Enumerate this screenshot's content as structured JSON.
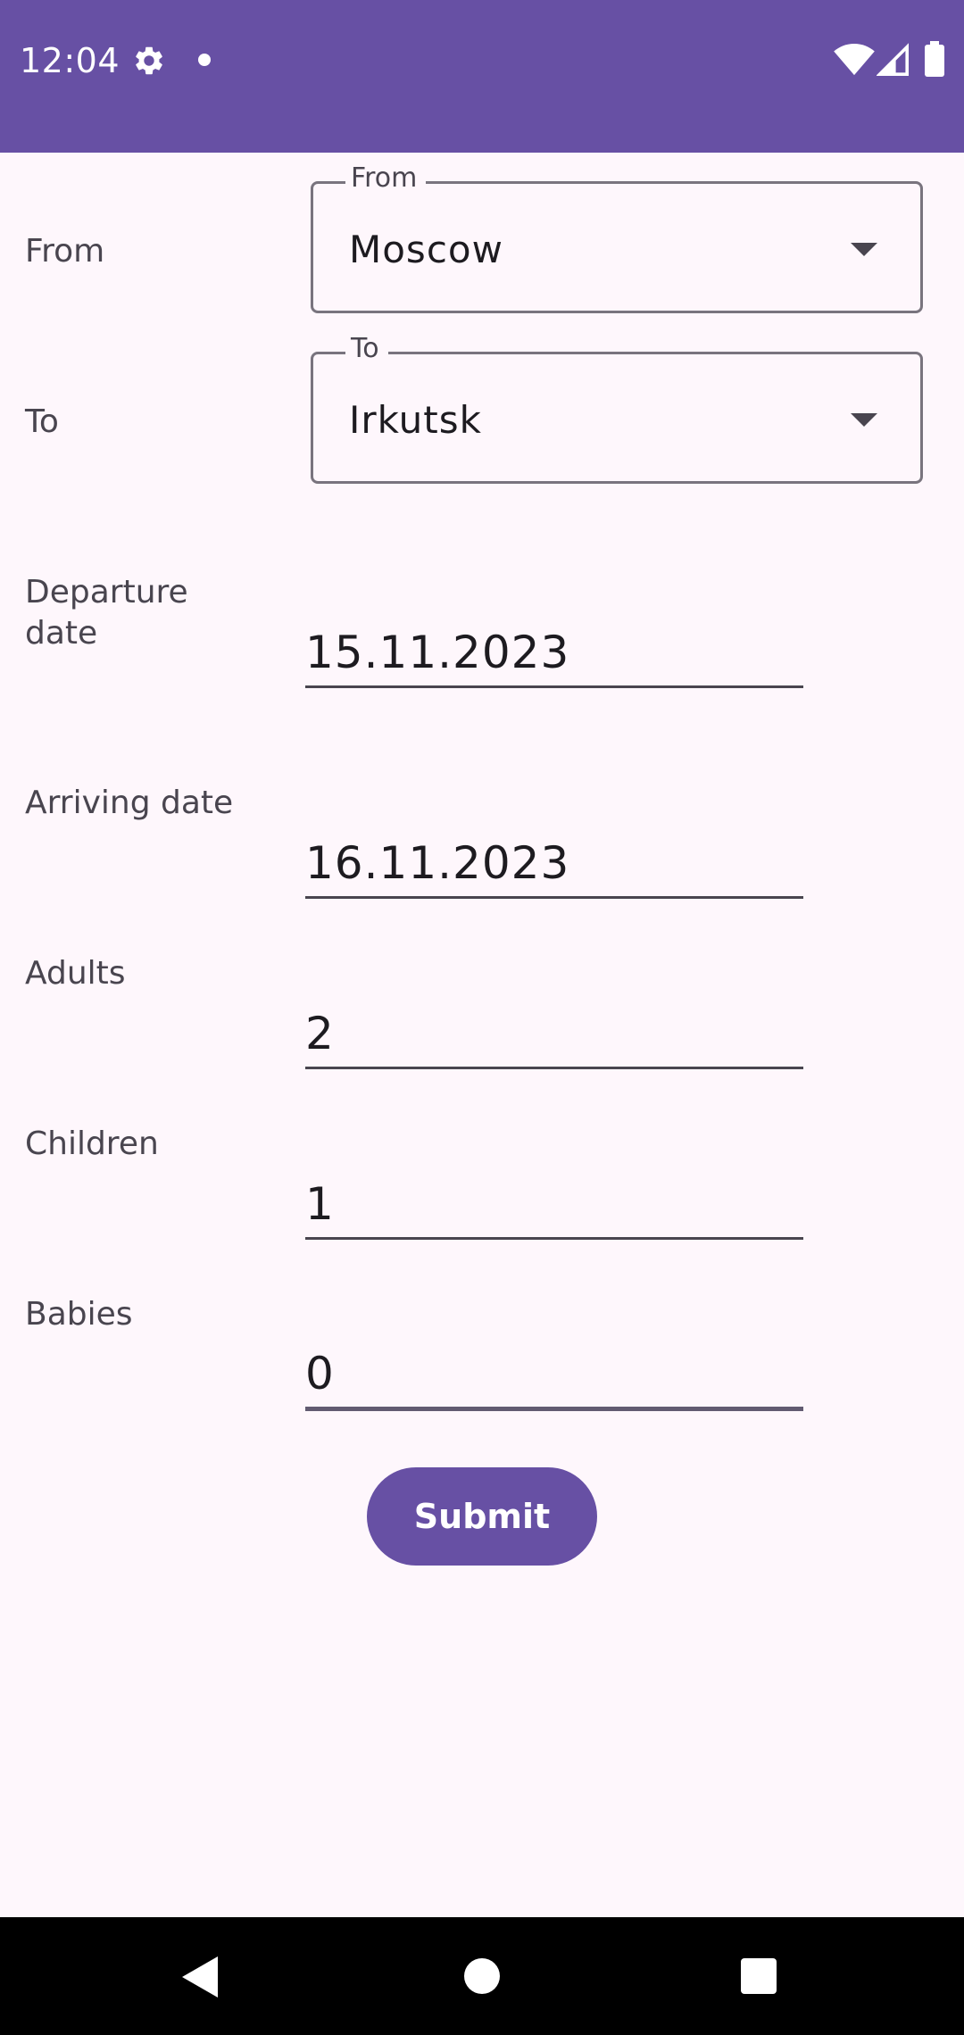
{
  "status_bar": {
    "time": "12:04",
    "icons": [
      "gear-icon",
      "dot-icon",
      "wifi-icon",
      "signal-icon",
      "battery-icon"
    ]
  },
  "form": {
    "from": {
      "label": "From",
      "legend": "From",
      "value": "Moscow"
    },
    "to": {
      "label": "To",
      "legend": "To",
      "value": "Irkutsk"
    },
    "departure_date": {
      "label_line1": "Departure",
      "label_line2": "date",
      "value": "15.11.2023"
    },
    "arriving_date": {
      "label": "Arriving date",
      "value": "16.11.2023"
    },
    "adults": {
      "label": "Adults",
      "value": "2"
    },
    "children": {
      "label": "Children",
      "value": "1"
    },
    "babies": {
      "label": "Babies",
      "value": "0"
    },
    "submit_label": "Submit"
  },
  "nav_bar": {
    "icons": [
      "back-icon",
      "home-icon",
      "recents-icon"
    ]
  },
  "colors": {
    "primary": "#6750A4",
    "background": "#FEF7FC",
    "outline": "#79747E",
    "text": "#1D1B20"
  }
}
